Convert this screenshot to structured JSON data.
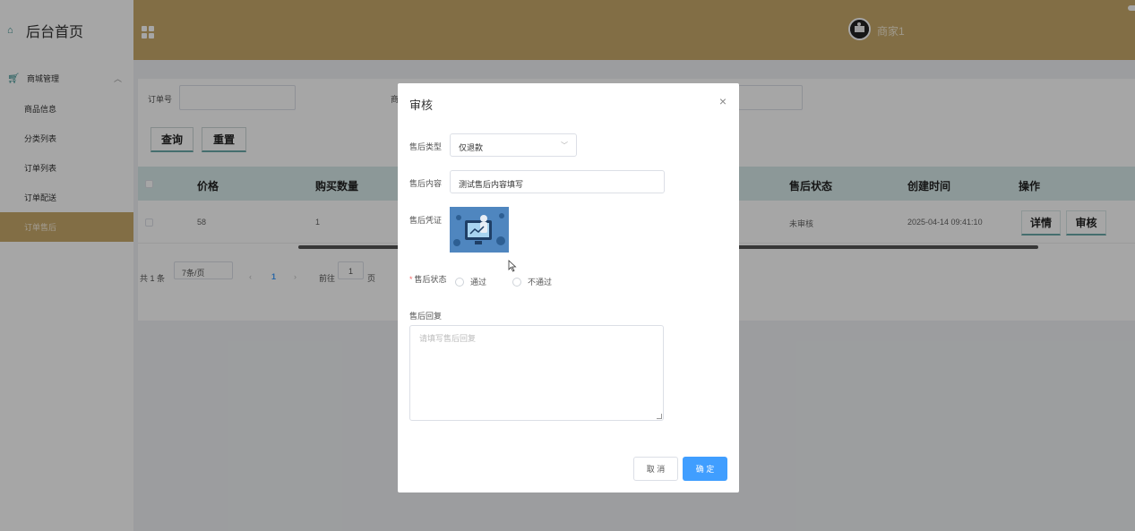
{
  "sidebar": {
    "home": "后台首页",
    "group": "商城管理",
    "items": [
      {
        "label": "商品信息"
      },
      {
        "label": "分类列表"
      },
      {
        "label": "订单列表"
      },
      {
        "label": "订单配送"
      },
      {
        "label": "订单售后"
      }
    ]
  },
  "header": {
    "username": "商家1"
  },
  "filters": {
    "order_label": "订单号",
    "product_label_partial": "商",
    "search_button": "查询",
    "reset_button": "重置"
  },
  "table": {
    "headers": [
      "价格",
      "购买数量",
      "售后状态",
      "创建时间",
      "操作"
    ],
    "rows": [
      {
        "price": "58",
        "quantity": "1",
        "status": "未审核",
        "created": "2025-04-14 09:41:10",
        "detail": "详情",
        "review": "审核"
      }
    ]
  },
  "pagination": {
    "total": "共 1 条",
    "page_size": "7条/页",
    "current": "1",
    "goto_prefix": "前往",
    "goto_value": "1",
    "goto_suffix": "页"
  },
  "modal": {
    "title": "审核",
    "type_label": "售后类型",
    "type_value": "仅退款",
    "content_label": "售后内容",
    "content_value": "测试售后内容填写",
    "proof_label": "售后凭证",
    "status_label": "售后状态",
    "status_options": [
      "通过",
      "不通过"
    ],
    "reply_label": "售后回复",
    "reply_placeholder": "请填写售后回复",
    "cancel": "取 消",
    "confirm": "确 定"
  },
  "colors": {
    "header": "#c8a96a",
    "accent": "#409eff",
    "table_header": "#d7eaea"
  }
}
